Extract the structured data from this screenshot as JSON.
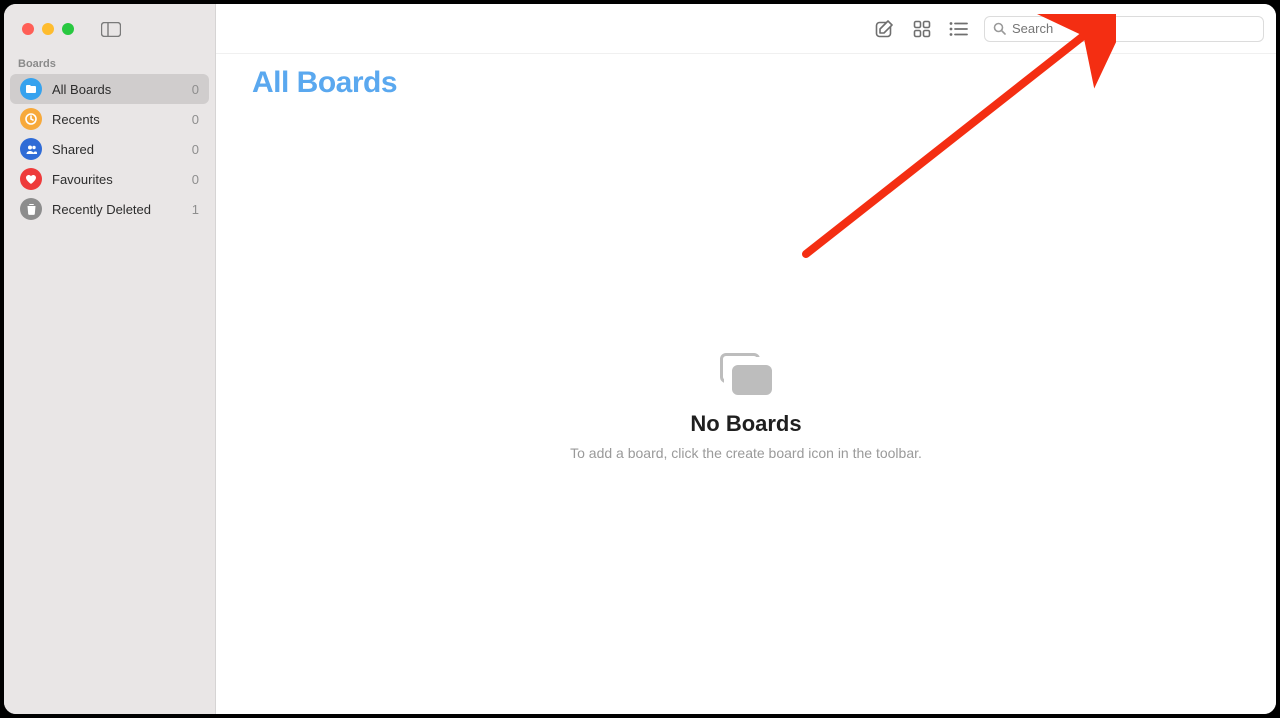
{
  "sidebar": {
    "section_label": "Boards",
    "items": [
      {
        "label": "All Boards",
        "count": "0",
        "icon_color": "#36a2ee",
        "icon": "folder"
      },
      {
        "label": "Recents",
        "count": "0",
        "icon_color": "#f7a93b",
        "icon": "clock"
      },
      {
        "label": "Shared",
        "count": "0",
        "icon_color": "#2f6bd6",
        "icon": "people"
      },
      {
        "label": "Favourites",
        "count": "0",
        "icon_color": "#ee3b3b",
        "icon": "heart"
      },
      {
        "label": "Recently Deleted",
        "count": "1",
        "icon_color": "#8d8d8d",
        "icon": "trash"
      }
    ]
  },
  "toolbar": {
    "search_placeholder": "Search"
  },
  "main": {
    "title": "All Boards",
    "empty_title": "No Boards",
    "empty_sub": "To add a board, click the create board icon in the toolbar."
  },
  "colors": {
    "accent": "#5aa8ef",
    "arrow": "#f42e12"
  }
}
